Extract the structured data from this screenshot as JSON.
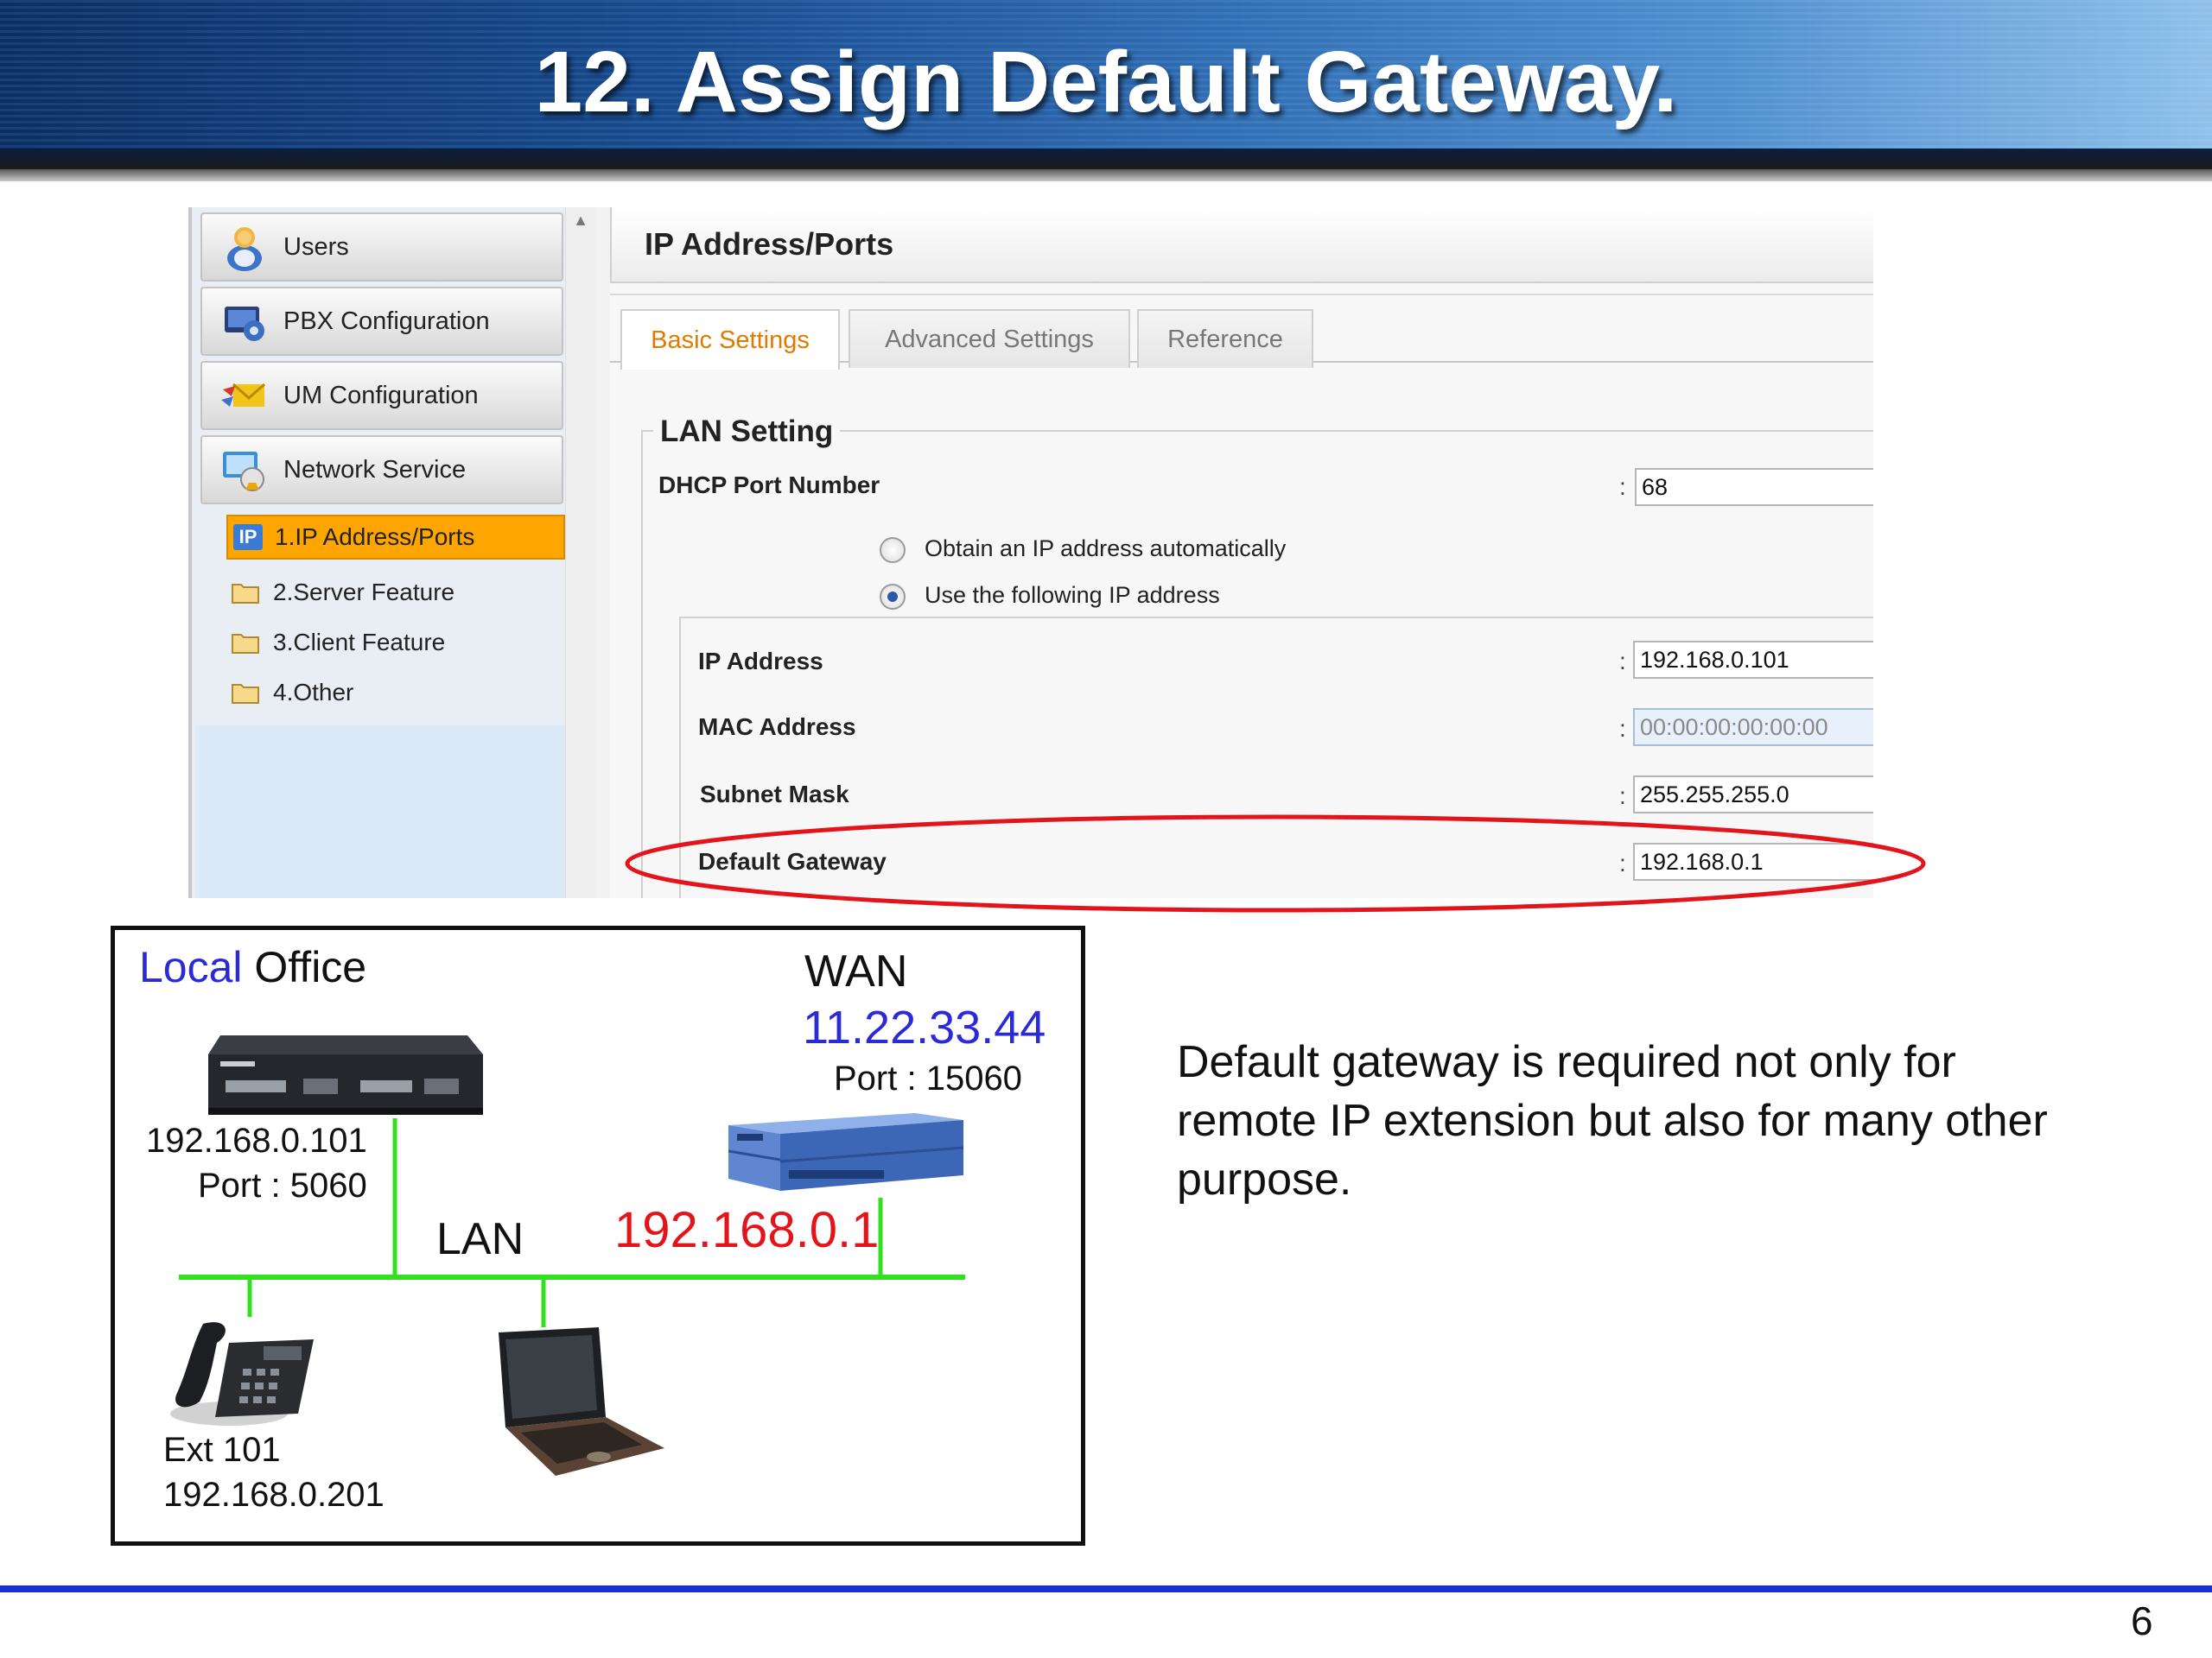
{
  "slide": {
    "title": "12. Assign Default Gateway.",
    "page_number": "6",
    "explanation": "Default gateway is required not only for remote IP extension but also for many other purpose."
  },
  "sidebar": {
    "nav_buttons": [
      {
        "label": "Users",
        "icon": "users-icon"
      },
      {
        "label": "PBX Configuration",
        "icon": "pbx-config-icon"
      },
      {
        "label": "UM Configuration",
        "icon": "um-config-icon"
      },
      {
        "label": "Network Service",
        "icon": "network-service-icon"
      }
    ],
    "sub_items": [
      {
        "label": "1.IP Address/Ports",
        "active": true,
        "badge": "IP"
      },
      {
        "label": "2.Server Feature",
        "active": false
      },
      {
        "label": "3.Client Feature",
        "active": false
      },
      {
        "label": "4.Other",
        "active": false
      }
    ]
  },
  "content": {
    "heading": "IP Address/Ports",
    "tabs": [
      {
        "label": "Basic Settings",
        "active": true
      },
      {
        "label": "Advanced Settings",
        "active": false
      },
      {
        "label": "Reference",
        "active": false
      }
    ],
    "section": "LAN Setting",
    "dhcp": {
      "label": "DHCP Port Number",
      "value": "68"
    },
    "radios": [
      {
        "label": "Obtain an IP address automatically",
        "checked": false
      },
      {
        "label": "Use the following IP address",
        "checked": true
      }
    ],
    "fields": [
      {
        "label": "IP Address",
        "value": "192.168.0.101",
        "readonly": false
      },
      {
        "label": "MAC Address",
        "value": "00:00:00:00:00:00",
        "readonly": true
      },
      {
        "label": "Subnet Mask",
        "value": "255.255.255.0",
        "readonly": false
      },
      {
        "label": "Default Gateway",
        "value": "192.168.0.1",
        "readonly": false
      }
    ],
    "colon": ":"
  },
  "diagram": {
    "title_blue": "Local",
    "title_black": " Office",
    "wan_label": "WAN",
    "wan_ip": "11.22.33.44",
    "wan_port": "Port : 15060",
    "pbx_ip": "192.168.0.101",
    "pbx_port": "Port : 5060",
    "lan_label": "LAN",
    "gateway_ip": "192.168.0.1",
    "ext_label": "Ext 101",
    "ext_ip": "192.168.0.201",
    "colors": {
      "blue": "#2a2ad8",
      "red": "#e4141b",
      "lan_line": "#33e020"
    }
  }
}
